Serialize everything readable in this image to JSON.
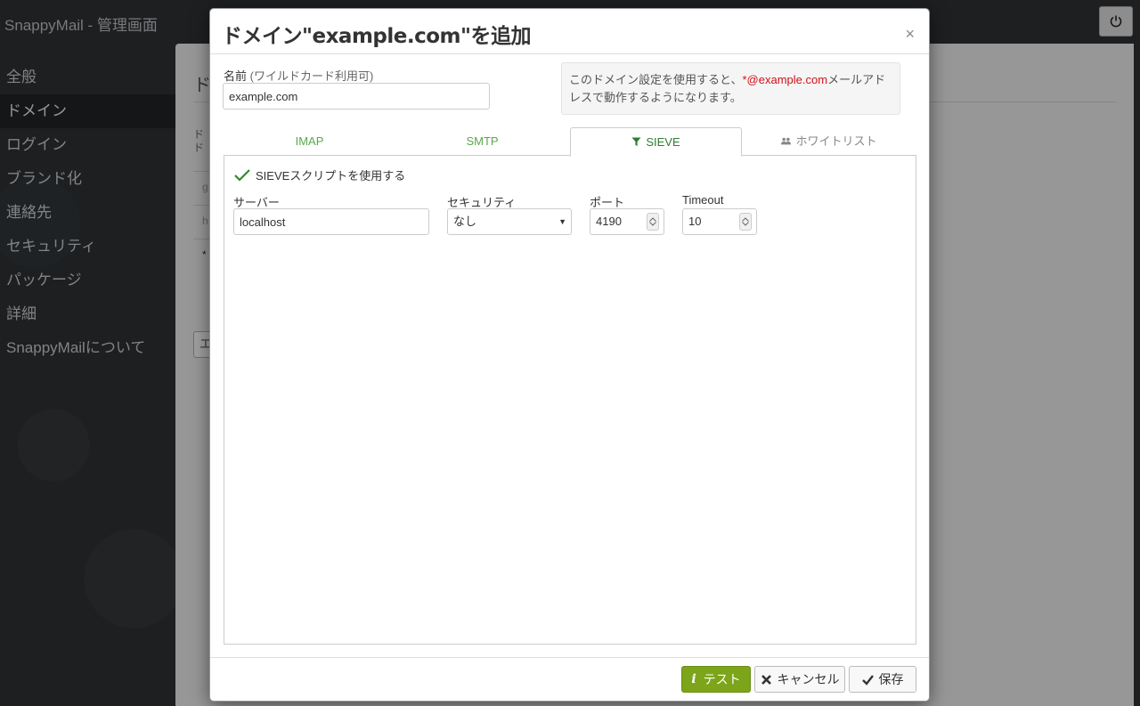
{
  "app": {
    "title": "SnappyMail - 管理画面"
  },
  "sidebar": {
    "items": [
      {
        "label": "全般"
      },
      {
        "label": "ドメイン",
        "active": true
      },
      {
        "label": "ログイン"
      },
      {
        "label": "ブランド化"
      },
      {
        "label": "連絡先"
      },
      {
        "label": "セキュリティ"
      },
      {
        "label": "パッケージ"
      },
      {
        "label": "詳細"
      },
      {
        "label": "SnappyMailについて"
      }
    ]
  },
  "background": {
    "heading": "ド",
    "table_header": "ド\nド",
    "rows": [
      "g",
      "h",
      "*"
    ],
    "button": "エ"
  },
  "modal": {
    "title": "ドメイン\"example.com\"を追加",
    "close": "×",
    "name_label": "名前",
    "name_hint": "(ワイルドカード利用可)",
    "name_value": "example.com",
    "info_prefix": "このドメイン設定を使用すると、",
    "info_highlight": "*@example.com",
    "info_suffix": "メールアドレスで動作するようになります。",
    "tabs": [
      {
        "label": "IMAP"
      },
      {
        "label": "SMTP"
      },
      {
        "label": "SIEVE",
        "active": true
      },
      {
        "label": "ホワイトリスト"
      }
    ],
    "sieve": {
      "use_sieve_label": "SIEVEスクリプトを使用する",
      "use_sieve_checked": true,
      "server_label": "サーバー",
      "server_value": "localhost",
      "security_label": "セキュリティ",
      "security_value": "なし",
      "port_label": "ポート",
      "port_value": "4190",
      "timeout_label": "Timeout",
      "timeout_value": "10"
    },
    "footer": {
      "test_label": "テスト",
      "cancel_label": "キャンセル",
      "save_label": "保存"
    }
  },
  "colors": {
    "accent_green": "#7ca51a",
    "tab_green": "#5ba84a",
    "highlight_red": "#d0111a"
  }
}
